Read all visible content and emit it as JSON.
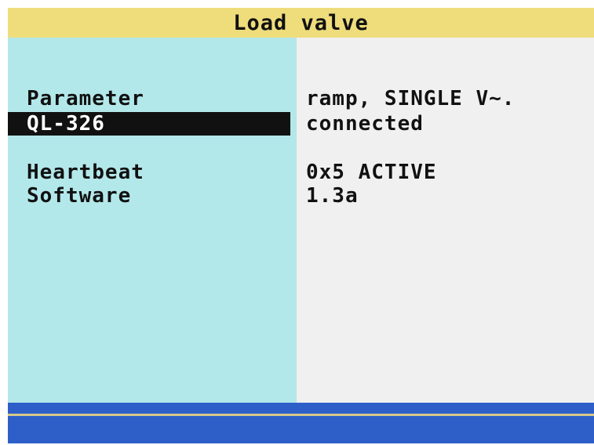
{
  "header": {
    "title": "Load valve"
  },
  "rows": [
    {
      "label": "Parameter",
      "value": "ramp, SINGLE V~."
    },
    {
      "label": "QL-326",
      "value": "connected",
      "selected": true
    },
    {
      "label": "Heartbeat",
      "value": "0x5 ACTIVE"
    },
    {
      "label": "Software",
      "value": "1.3a"
    }
  ],
  "colors": {
    "title_bar": "#efdd7c",
    "left_pane": "#b3e8ea",
    "right_pane": "#f0f0f0",
    "selection": "#111111",
    "bottom_bar": "#2e5fc9"
  }
}
